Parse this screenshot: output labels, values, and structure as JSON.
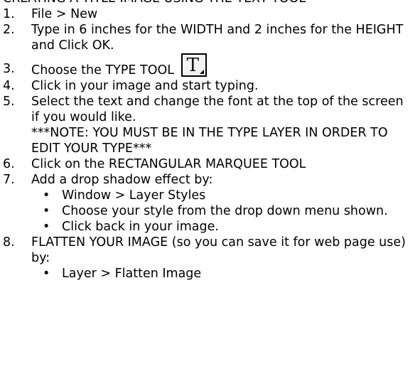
{
  "heading": "CREATING A TITLE IMAGE USING THE TEXT TOOL",
  "steps": [
    {
      "num": "1.",
      "text": "File > New"
    },
    {
      "num": "2.",
      "text": "Type in 6 inches for the WIDTH and 2 inches for the HEIGHT and Click OK."
    },
    {
      "num": "3.",
      "text": "Choose the TYPE TOOL"
    },
    {
      "num": "4.",
      "text": "Click in your image and start typing."
    },
    {
      "num": "5.",
      "text": "Select the text and change the font at the top of the screen if you would like.",
      "note": "***NOTE: YOU MUST BE IN THE TYPE LAYER IN ORDER TO EDIT YOUR TYPE***"
    },
    {
      "num": "6.",
      "text": "Click on the RECTANGULAR MARQUEE TOOL"
    },
    {
      "num": "7.",
      "text": "Add a drop shadow effect by:",
      "sub": [
        "Window > Layer Styles",
        "Choose your style from the drop down menu shown.",
        "Click back in your image."
      ]
    },
    {
      "num": "8.",
      "text": "FLATTEN YOUR IMAGE  (so you can save it for web page use) by:",
      "sub": [
        "Layer > Flatten Image"
      ]
    }
  ],
  "bullet_char": "•",
  "type_tool_icon": {
    "glyph": "T",
    "icon": "type-tool-icon"
  }
}
